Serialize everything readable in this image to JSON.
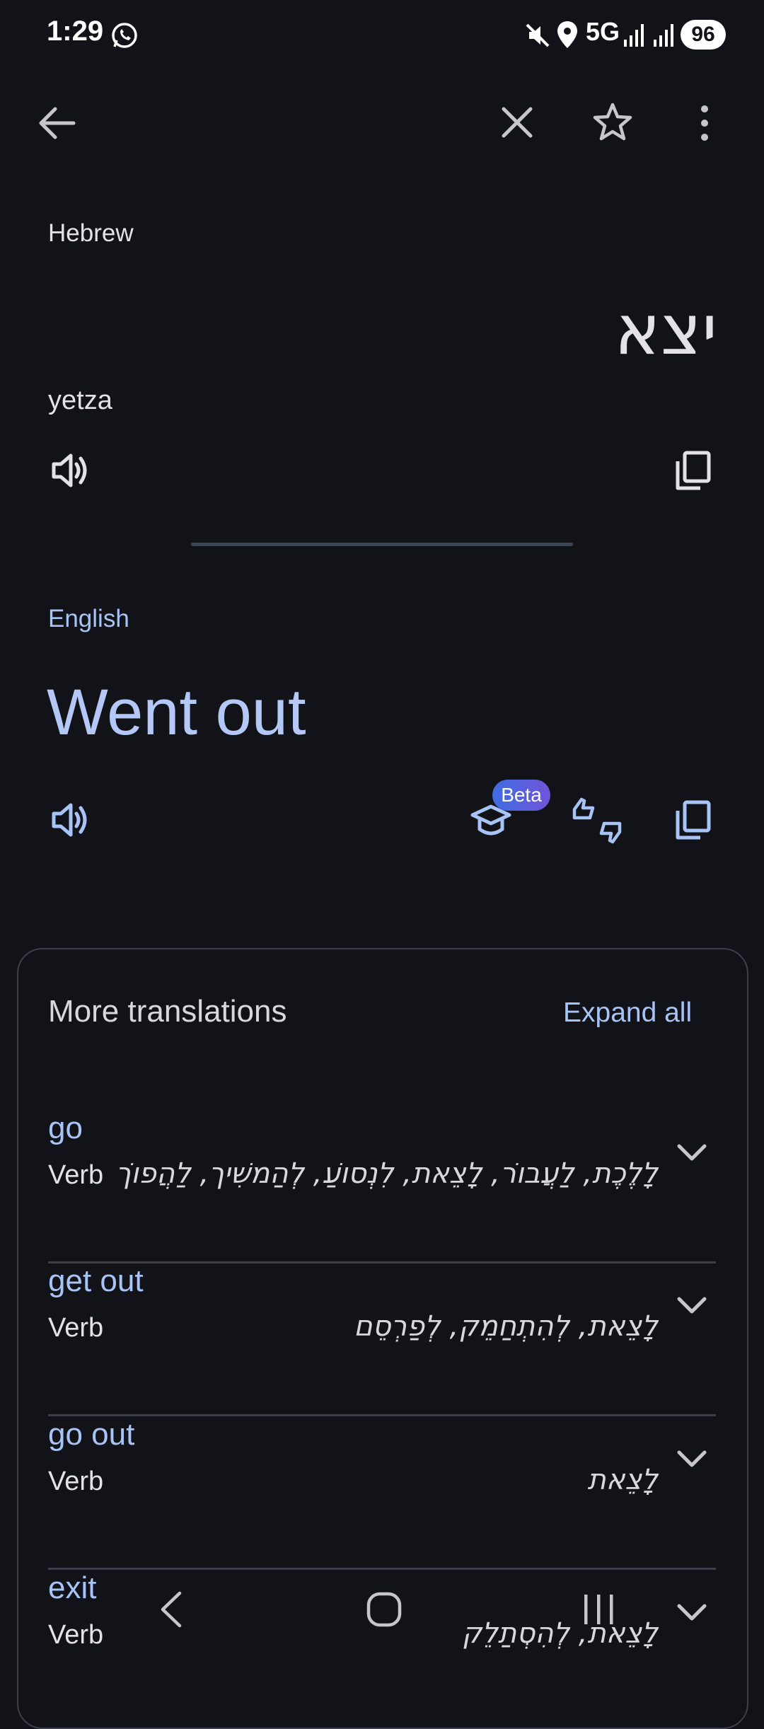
{
  "status": {
    "time": "1:29",
    "network": "5G",
    "battery": "96"
  },
  "source": {
    "language": "Hebrew",
    "text": "יצא",
    "transliteration": "yetza"
  },
  "target": {
    "language": "English",
    "text": "Went out",
    "beta_badge": "Beta"
  },
  "more_translations": {
    "title": "More translations",
    "expand_label": "Expand all",
    "items": [
      {
        "word": "go",
        "pos": "Verb",
        "synonyms": "לָלֶכֶת, לַעֲבוֹר, לָצֵאת, לִנְסוֹעַ, לְהַמשִׁיך, לַהֲפוֹך"
      },
      {
        "word": "get out",
        "pos": "Verb",
        "synonyms": "לָצֵאת, לְהִתְחַמֵק, לְפַרְסֵם"
      },
      {
        "word": "go out",
        "pos": "Verb",
        "synonyms": "לָצֵאת"
      },
      {
        "word": "exit",
        "pos": "Verb",
        "synonyms": "לָצֵאת, לְהִסְתַלֵק"
      }
    ]
  },
  "colors": {
    "background": "#121318",
    "accent": "#a8c4f6",
    "target_text": "#b3c8f7"
  }
}
